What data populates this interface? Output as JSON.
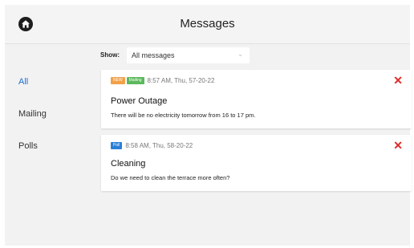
{
  "header": {
    "title": "Messages",
    "home_icon": "home-icon"
  },
  "sidebar": {
    "items": [
      {
        "label": "All",
        "active": true
      },
      {
        "label": "Mailing",
        "active": false
      },
      {
        "label": "Polls",
        "active": false
      }
    ]
  },
  "filter": {
    "label": "Show:",
    "value": "All messages"
  },
  "messages": [
    {
      "badges": [
        {
          "label": "NEW",
          "color": "#f0a14a"
        },
        {
          "label": "Mailing",
          "color": "#5cb85c"
        }
      ],
      "timestamp": "8:57 AM, Thu, 57-20-22",
      "subject": "Power Outage",
      "body": "There will be no electricity tomorrow from 16 to 17 pm."
    },
    {
      "badges": [
        {
          "label": "Poll",
          "color": "#2a7fd6"
        }
      ],
      "timestamp": "8:58 AM, Thu, 58-20-22",
      "subject": "Cleaning",
      "body": "Do we need to clean the terrace more often?"
    }
  ],
  "colors": {
    "accent": "#1a6fd8",
    "delete": "#e02a2a",
    "background": "#f2f2f2"
  }
}
